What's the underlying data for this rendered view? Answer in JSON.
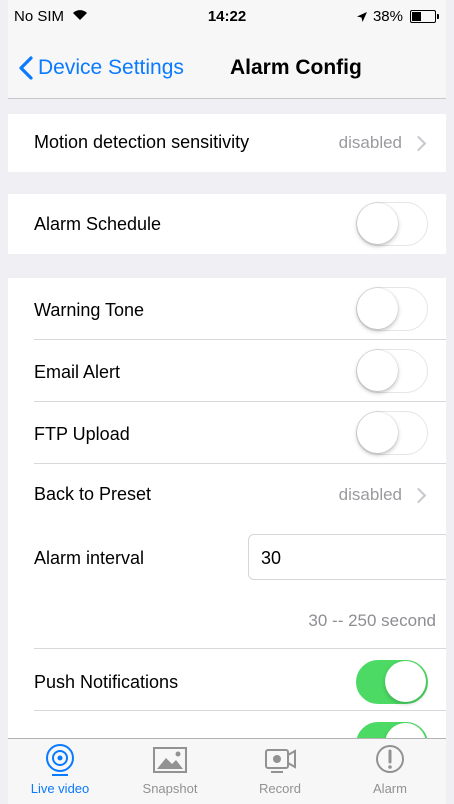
{
  "status_bar": {
    "carrier": "No SIM",
    "time": "14:22",
    "battery": "38%"
  },
  "nav": {
    "back_label": "Device Settings",
    "title": "Alarm Config"
  },
  "rows": {
    "motion": {
      "label": "Motion detection sensitivity",
      "value": "disabled"
    },
    "schedule": {
      "label": "Alarm Schedule",
      "on": false
    },
    "warning_tone": {
      "label": "Warning Tone",
      "on": false
    },
    "email_alert": {
      "label": "Email Alert",
      "on": false
    },
    "ftp_upload": {
      "label": "FTP Upload",
      "on": false
    },
    "back_to_preset": {
      "label": "Back to Preset",
      "value": "disabled"
    },
    "alarm_interval": {
      "label": "Alarm interval",
      "value": "30",
      "hint": "30 -- 250 second"
    },
    "push": {
      "label": "Push Notifications",
      "on": true
    }
  },
  "tabs": [
    {
      "label": "Live video",
      "icon": "live-video-icon",
      "active": true
    },
    {
      "label": "Snapshot",
      "icon": "snapshot-icon",
      "active": false
    },
    {
      "label": "Record",
      "icon": "record-icon",
      "active": false
    },
    {
      "label": "Alarm",
      "icon": "alarm-icon",
      "active": false
    }
  ],
  "colors": {
    "accent": "#0a7aff",
    "toggle_on": "#4cd964",
    "background": "#efeff4"
  }
}
